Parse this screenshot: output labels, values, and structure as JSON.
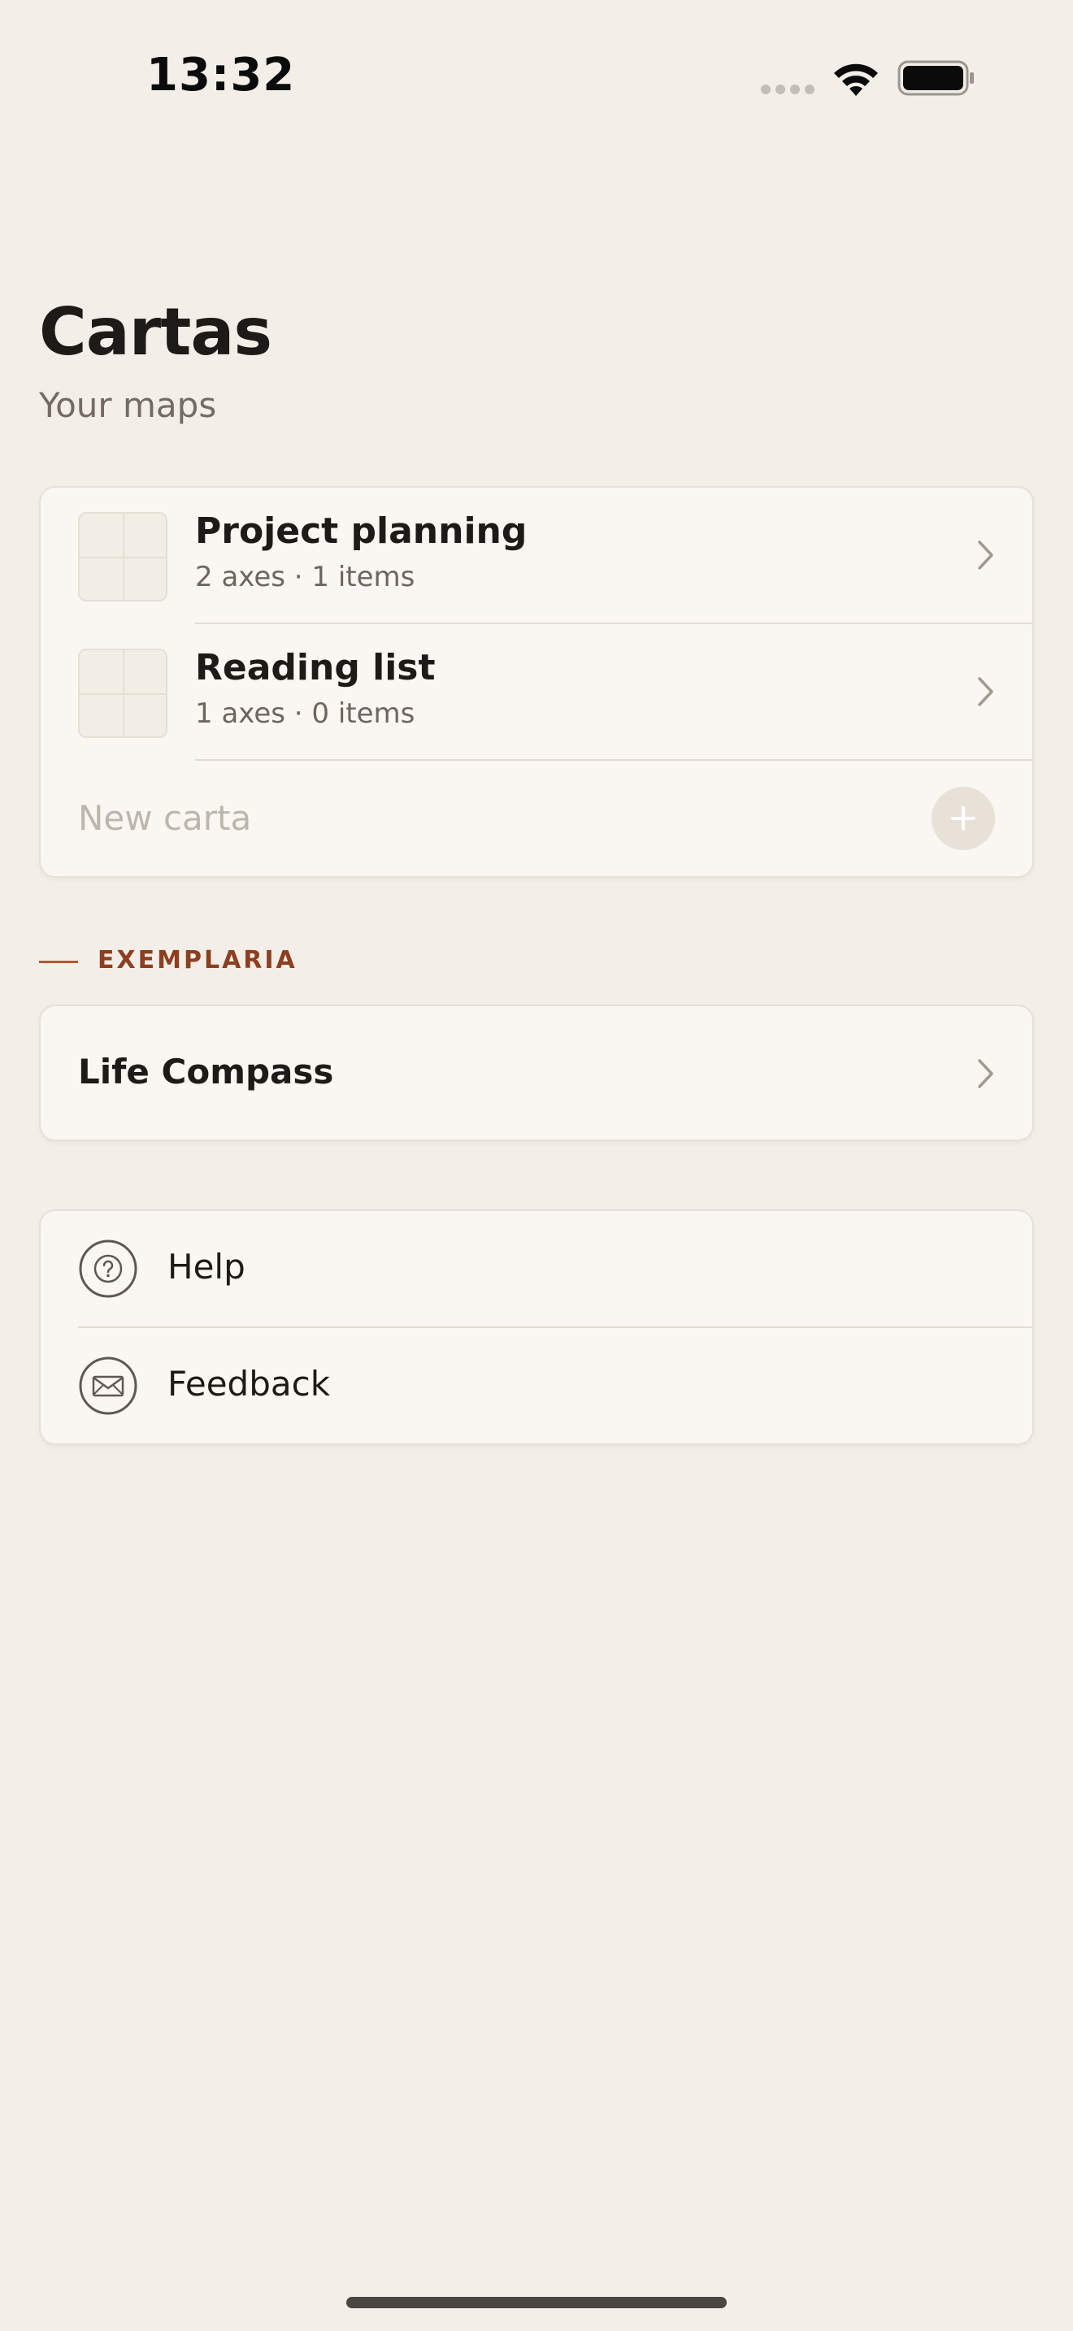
{
  "status_bar": {
    "time": "13:32"
  },
  "header": {
    "title": "Cartas",
    "subtitle": "Your maps"
  },
  "maps": {
    "items": [
      {
        "title": "Project planning",
        "meta": "2 axes · 1 items"
      },
      {
        "title": "Reading list",
        "meta": "1 axes · 0 items"
      }
    ],
    "new_placeholder": "New carta"
  },
  "examples": {
    "section_label": "EXEMPLARIA",
    "items": [
      {
        "title": "Life Compass"
      }
    ]
  },
  "support": {
    "help_label": "Help",
    "feedback_label": "Feedback"
  },
  "icons": {
    "chevron": "chevron-right-icon",
    "add": "plus-icon",
    "help": "question-circle-icon",
    "feedback": "envelope-icon",
    "wifi": "wifi-icon",
    "battery": "battery-icon"
  },
  "colors": {
    "background": "#f3eee8",
    "card": "#faf7f2",
    "accent": "#8c3f21",
    "accent_rule": "#b4572e",
    "muted_text": "#736b63",
    "placeholder": "#bdb6ad"
  }
}
